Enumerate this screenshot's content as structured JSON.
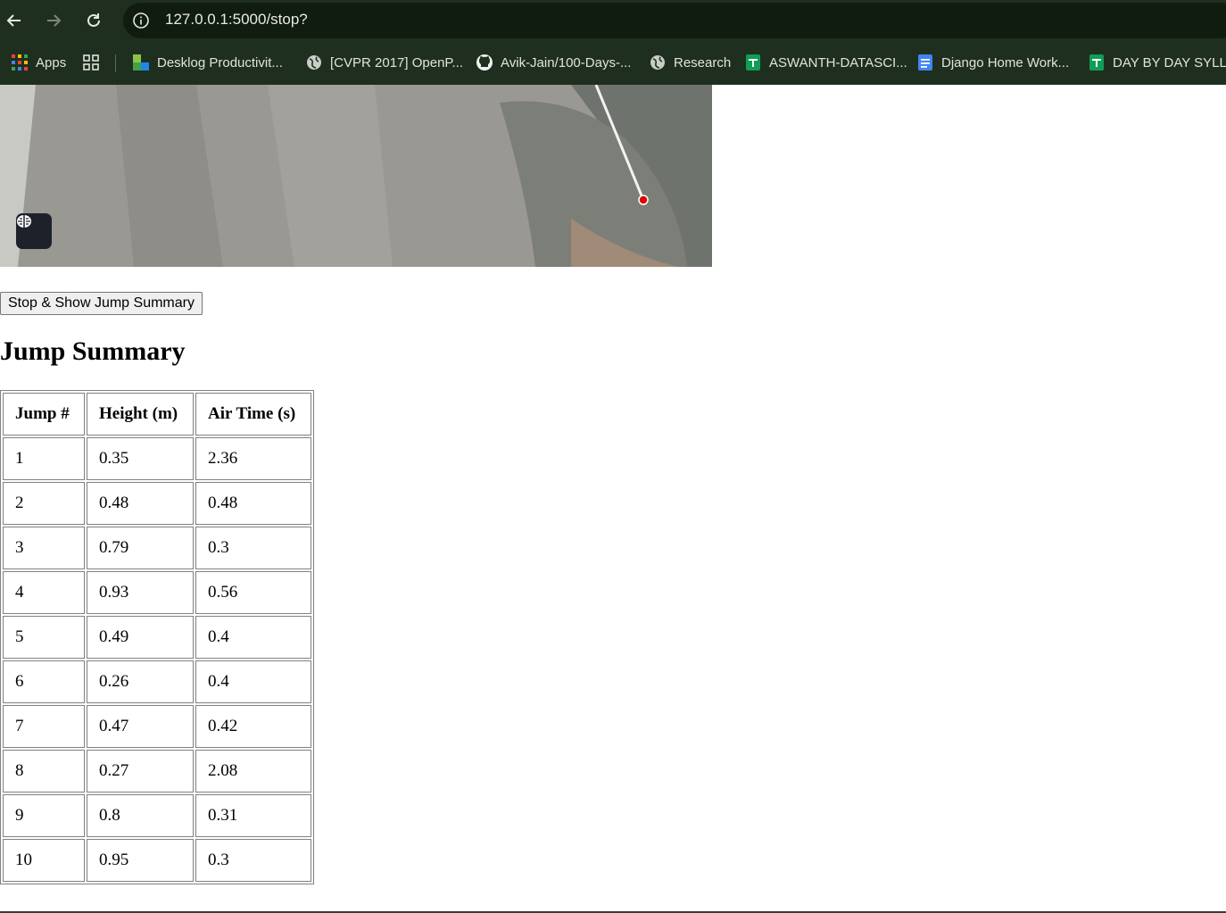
{
  "browser": {
    "url": "127.0.0.1:5000/stop?",
    "bookmarks": [
      {
        "label": "Apps",
        "icon": "apps-grid-icon"
      },
      {
        "label": "",
        "icon": "tab-groups-icon"
      },
      {
        "label": "Desklog Productivit...",
        "icon": "desklog-icon"
      },
      {
        "label": "[CVPR 2017] OpenP...",
        "icon": "globe-icon"
      },
      {
        "label": "Avik-Jain/100-Days-...",
        "icon": "github-icon"
      },
      {
        "label": "Research",
        "icon": "globe-icon"
      },
      {
        "label": "ASWANTH-DATASCI...",
        "icon": "google-sheets-icon"
      },
      {
        "label": "Django Home Work...",
        "icon": "google-docs-icon"
      },
      {
        "label": "DAY BY DAY SYLLAB",
        "icon": "google-sheets-icon"
      }
    ]
  },
  "page": {
    "stop_button_label": "Stop & Show Jump Summary",
    "summary_title": "Jump Summary",
    "table": {
      "headers": [
        "Jump #",
        "Height (m)",
        "Air Time (s)"
      ],
      "rows": [
        [
          "1",
          "0.35",
          "2.36"
        ],
        [
          "2",
          "0.48",
          "0.48"
        ],
        [
          "3",
          "0.79",
          "0.3"
        ],
        [
          "4",
          "0.93",
          "0.56"
        ],
        [
          "5",
          "0.49",
          "0.4"
        ],
        [
          "6",
          "0.26",
          "0.4"
        ],
        [
          "7",
          "0.47",
          "0.42"
        ],
        [
          "8",
          "0.27",
          "2.08"
        ],
        [
          "9",
          "0.8",
          "0.31"
        ],
        [
          "10",
          "0.95",
          "0.3"
        ]
      ]
    }
  },
  "colors": {
    "chrome_bg": "#1f2f1f",
    "omnibox_bg": "#101c10",
    "landmark_dot": "#e00000"
  }
}
